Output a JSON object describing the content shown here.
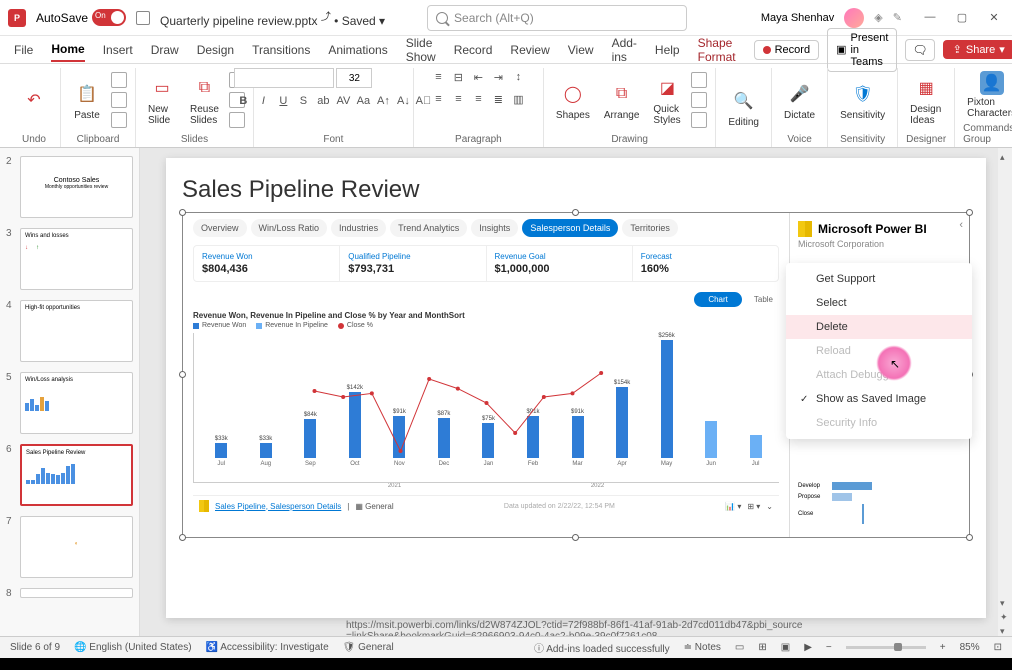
{
  "titlebar": {
    "autosave": "AutoSave",
    "autosave_state": "On",
    "filename": "Quarterly pipeline review.pptx",
    "save_state": "• Saved",
    "search_placeholder": "Search (Alt+Q)",
    "user": "Maya Shenhav"
  },
  "tabs": {
    "items": [
      "File",
      "Home",
      "Insert",
      "Draw",
      "Design",
      "Transitions",
      "Animations",
      "Slide Show",
      "Record",
      "Review",
      "View",
      "Add-ins",
      "Help",
      "Shape Format"
    ],
    "active": "Home",
    "record_btn": "Record",
    "teams_btn": "Present in Teams",
    "share_btn": "Share"
  },
  "ribbon": {
    "undo": "Undo",
    "clipboard": "Clipboard",
    "paste": "Paste",
    "slides": "Slides",
    "new_slide": "New Slide",
    "reuse_slides": "Reuse Slides",
    "font": "Font",
    "font_size": "32",
    "paragraph": "Paragraph",
    "drawing": "Drawing",
    "shapes": "Shapes",
    "arrange": "Arrange",
    "quick_styles": "Quick Styles",
    "editing": "Editing",
    "voice": "Voice",
    "dictate": "Dictate",
    "sensitivity": "Sensitivity",
    "designer": "Designer",
    "design_ideas": "Design Ideas",
    "commands": "Commands Group",
    "pixton": "Pixton Characters"
  },
  "thumbnails": [
    {
      "n": "2",
      "title": "Contoso Sales",
      "sub": "Monthly opportunities review"
    },
    {
      "n": "3",
      "title": "Wins and losses"
    },
    {
      "n": "4",
      "title": "High-fit opportunities"
    },
    {
      "n": "5",
      "title": "Win/Loss analysis"
    },
    {
      "n": "6",
      "title": "Sales Pipeline Review",
      "active": true
    },
    {
      "n": "7",
      "title": ""
    },
    {
      "n": "8",
      "title": ""
    }
  ],
  "slide": {
    "title": "Sales Pipeline Review"
  },
  "powerbi": {
    "tabs": [
      "Overview",
      "Win/Loss Ratio",
      "Industries",
      "Trend Analytics",
      "Insights",
      "Salesperson Details",
      "Territories"
    ],
    "active_tab": "Salesperson Details",
    "kpis": [
      {
        "label": "Revenue Won",
        "value": "$804,436"
      },
      {
        "label": "Qualified Pipeline",
        "value": "$793,731"
      },
      {
        "label": "Revenue Goal",
        "value": "$1,000,000"
      },
      {
        "label": "Forecast",
        "value": "160%"
      }
    ],
    "chart_btn": "Chart",
    "table_btn": "Table",
    "chart_title": "Revenue Won, Revenue In Pipeline and Close % by Year and MonthSort",
    "legend": [
      "Revenue Won",
      "Revenue In Pipeline",
      "Close %"
    ],
    "footer_link": "Sales Pipeline, Salesperson Details",
    "footer_sep": "|",
    "footer_general": "General",
    "footer_date": "Data updated on 2/22/22, 12:54 PM",
    "brand": "Microsoft Power BI",
    "corp": "Microsoft Corporation",
    "context_menu": [
      "Get Support",
      "Select",
      "Delete",
      "Reload",
      "Attach Debugger",
      "Show as Saved Image",
      "Security Info"
    ],
    "mini_stages": [
      "Develop",
      "Propose",
      "Close"
    ]
  },
  "chart_data": {
    "type": "bar",
    "categories": [
      "Jul",
      "Aug",
      "Sep",
      "Oct",
      "Nov",
      "Dec",
      "Jan",
      "Feb",
      "Mar",
      "Apr",
      "May",
      "Jun",
      "Jul"
    ],
    "year_groups": [
      "2021",
      "2022"
    ],
    "series": [
      {
        "name": "Revenue Won",
        "values": [
          33000,
          33000,
          84000,
          142000,
          91000,
          87000,
          75000,
          91000,
          91000,
          154000,
          256000,
          0,
          0
        ],
        "labels": [
          "$33k",
          "$33k",
          "$84k",
          "$142k",
          "$91k",
          "$87k",
          "$75k",
          "$91k",
          "$91k",
          "$154k",
          "$256k",
          "",
          ""
        ]
      },
      {
        "name": "Revenue In Pipeline",
        "values": [
          0,
          0,
          0,
          0,
          0,
          0,
          0,
          0,
          0,
          0,
          0,
          80000,
          50000
        ]
      },
      {
        "name": "Close %",
        "values": [
          60,
          55,
          58,
          10,
          70,
          62,
          50,
          25,
          55,
          58,
          75,
          null,
          null
        ]
      }
    ],
    "ylim": [
      0,
      260000
    ]
  },
  "url": "https://msit.powerbi.com/links/d2W874ZJOL?ctid=72f988bf-86f1-41af-91ab-2d7cd011db47&pbi_source=linkShare&bookmarkGuid=62966903-94c0-4ac2-b09e-39c0f7261c08",
  "status": {
    "slide": "Slide 6 of 9",
    "lang": "English (United States)",
    "access": "Accessibility: Investigate",
    "general": "General",
    "addins": "Add-ins loaded successfully",
    "notes": "Notes",
    "zoom": "85%"
  }
}
